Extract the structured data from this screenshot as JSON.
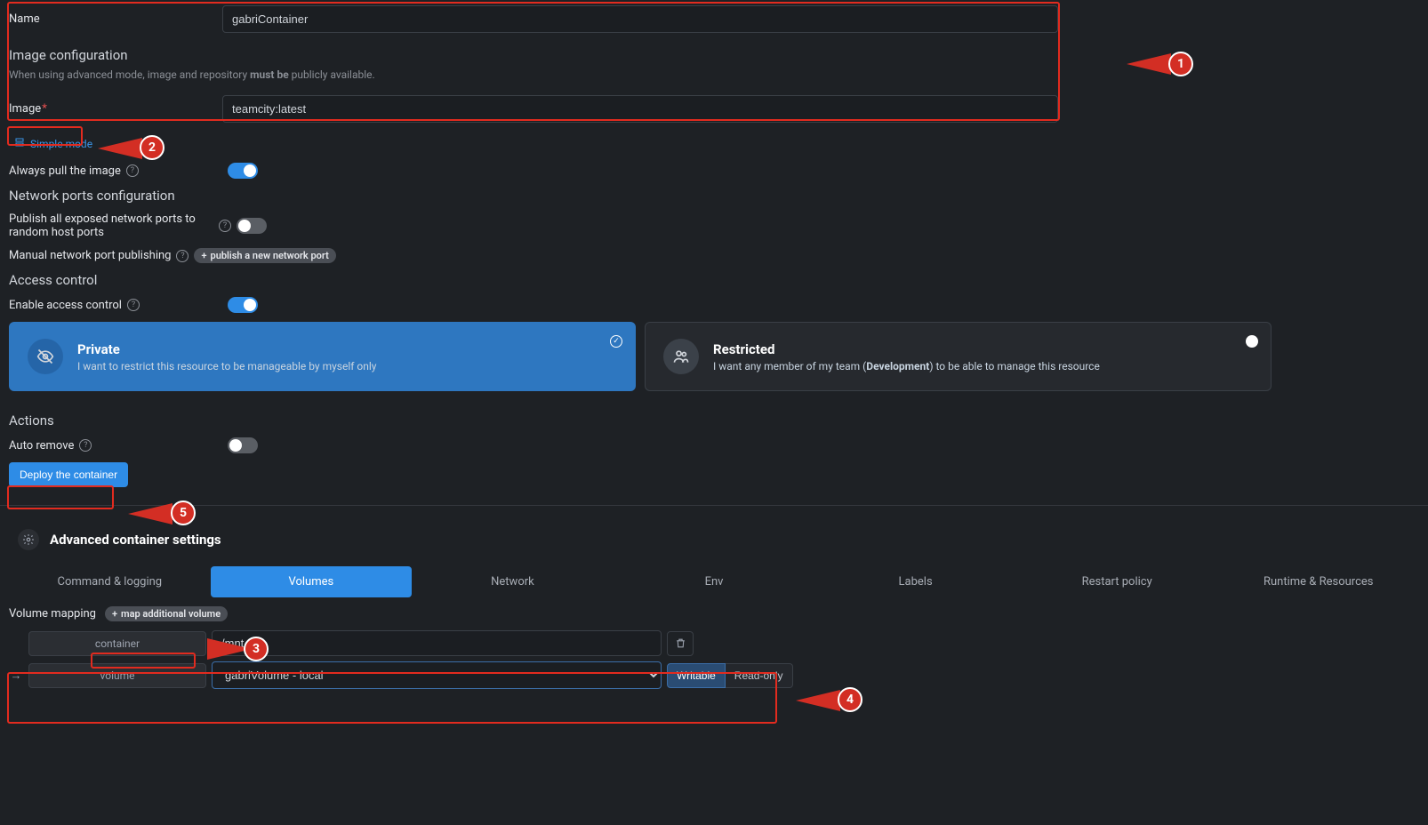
{
  "form": {
    "name_label": "Name",
    "name_value": "gabriContainer",
    "image_config_title": "Image configuration",
    "image_config_desc_pre": "When using advanced mode, image and repository ",
    "image_config_desc_bold": "must be",
    "image_config_desc_post": " publicly available.",
    "image_label": "Image",
    "image_value": "teamcity:latest",
    "simple_mode_label": "Simple mode",
    "always_pull_label": "Always pull the image",
    "network_title": "Network ports configuration",
    "publish_all_label": "Publish all exposed network ports to random host ports",
    "manual_publish_label": "Manual network port publishing",
    "publish_port_btn": "publish a new network port",
    "access_title": "Access control",
    "enable_access_label": "Enable access control",
    "actions_title": "Actions",
    "auto_remove_label": "Auto remove",
    "deploy_btn": "Deploy the container"
  },
  "access_cards": {
    "private": {
      "title": "Private",
      "desc": "I want to restrict this resource to be manageable by myself only"
    },
    "restricted": {
      "title": "Restricted",
      "desc_pre": "I want any member of my team (",
      "desc_bold": "Development",
      "desc_post": ") to be able to manage this resource"
    }
  },
  "advanced": {
    "title": "Advanced container settings",
    "tabs": [
      "Command & logging",
      "Volumes",
      "Network",
      "Env",
      "Labels",
      "Restart policy",
      "Runtime & Resources"
    ],
    "active_tab": 1
  },
  "volumes": {
    "mapping_label": "Volume mapping",
    "map_btn": "map additional volume",
    "container_seg": "container",
    "container_value": "/mnt",
    "volume_seg": "volume",
    "volume_value": "gabriVolume - local",
    "mode_writable": "Writable",
    "mode_readonly": "Read-only"
  },
  "callouts": {
    "c1": "1",
    "c2": "2",
    "c3": "3",
    "c4": "4",
    "c5": "5"
  }
}
